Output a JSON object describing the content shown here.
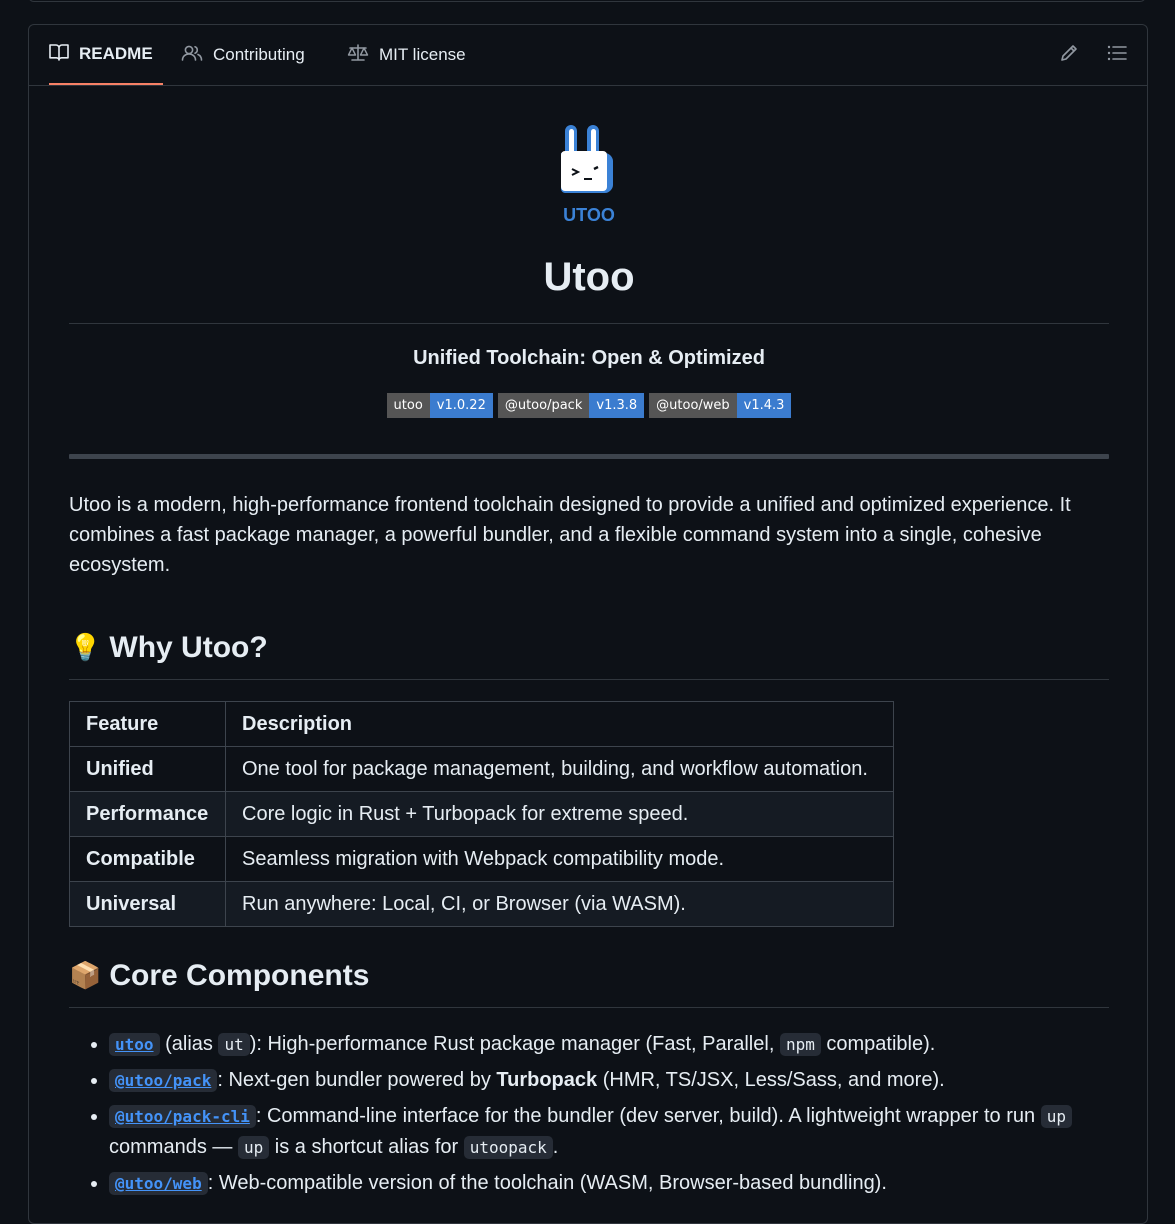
{
  "tabs": [
    {
      "label": "README",
      "icon": "book-icon"
    },
    {
      "label": "Contributing",
      "icon": "people-icon"
    },
    {
      "label": "MIT license",
      "icon": "law-scale-icon"
    }
  ],
  "toolbar": {
    "edit_icon": "pencil-icon",
    "outline_icon": "list-unordered-icon"
  },
  "readme": {
    "logo_text": "UTOO",
    "title": "Utoo",
    "subtitle": "Unified Toolchain: Open & Optimized",
    "badges": [
      {
        "label": "utoo",
        "version": "v1.0.22"
      },
      {
        "label": "@utoo/pack",
        "version": "v1.3.8"
      },
      {
        "label": "@utoo/web",
        "version": "v1.4.3"
      }
    ],
    "intro": "Utoo is a modern, high-performance frontend toolchain designed to provide a unified and optimized experience. It combines a fast package manager, a powerful bundler, and a flexible command system into a single, cohesive ecosystem.",
    "why": {
      "emoji": "💡",
      "heading": "Why Utoo?",
      "table": {
        "headers": [
          "Feature",
          "Description"
        ],
        "rows": [
          [
            "Unified",
            "One tool for package management, building, and workflow automation."
          ],
          [
            "Performance",
            "Core logic in Rust + Turbopack for extreme speed."
          ],
          [
            "Compatible",
            "Seamless migration with Webpack compatibility mode."
          ],
          [
            "Universal",
            "Run anywhere: Local, CI, or Browser (via WASM)."
          ]
        ]
      }
    },
    "core": {
      "emoji": "📦",
      "heading": "Core Components",
      "items": [
        {
          "link": "utoo",
          "t1": " (alias ",
          "c1": "ut",
          "t2": "): High-performance Rust package manager (Fast, Parallel, ",
          "c2": "npm",
          "t3": " compatible)."
        },
        {
          "link": "@utoo/pack",
          "t1": ": Next-gen bundler powered by ",
          "bold": "Turbopack",
          "t2": " (HMR, TS/JSX, Less/Sass, and more)."
        },
        {
          "link": "@utoo/pack-cli",
          "t1": ": Command-line interface for the bundler (dev server, build). A lightweight wrapper to run ",
          "c1": "up",
          "t2": " commands — ",
          "c2": "up",
          "t3": " is a shortcut alias for ",
          "c3": "utoopack",
          "t4": "."
        },
        {
          "link": "@utoo/web",
          "t1": ": Web-compatible version of the toolchain (WASM, Browser-based bundling)."
        }
      ]
    }
  }
}
